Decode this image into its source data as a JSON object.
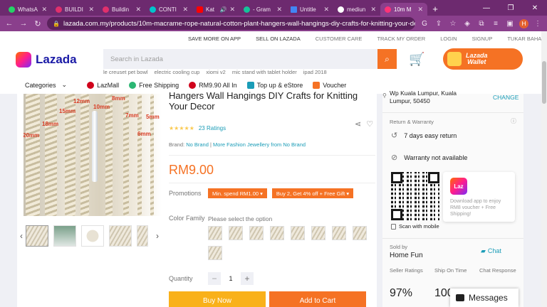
{
  "browser": {
    "tabs": [
      {
        "title": "WhatsA",
        "color": "#25d366",
        "active": false
      },
      {
        "title": "BUILDI",
        "color": "#e1306c",
        "active": false
      },
      {
        "title": "Buildin",
        "color": "#e1306c",
        "active": false
      },
      {
        "title": "CONTI",
        "color": "#00c4cc",
        "active": false
      },
      {
        "title": "Kat",
        "color": "#ff0000",
        "active": false,
        "audio": "🔊"
      },
      {
        "title": "- Gram",
        "color": "#15c39a",
        "active": false
      },
      {
        "title": "Untitle",
        "color": "#4285f4",
        "active": false
      },
      {
        "title": "mediun",
        "color": "#ffffff",
        "active": false
      },
      {
        "title": "10m M",
        "color": "#f36",
        "active": true
      }
    ],
    "new_tab": "+",
    "window_controls": [
      "—",
      "❐",
      "✕"
    ],
    "url": "lazada.com.my/products/10m-macrame-rope-natural-cotton-plant-hangers-wall-hangings-diy-crafts-for-knitting-your-decor-i1...",
    "profile_initial": "H"
  },
  "header": {
    "top_links": [
      "SAVE MORE ON APP",
      "SELL ON LAZADA",
      "CUSTOMER CARE",
      "TRACK MY ORDER",
      "LOGIN",
      "SIGNUP",
      "TUKAR BAHASA"
    ],
    "logo": "Lazada",
    "search_placeholder": "Search in Lazada",
    "wallet": "Lazada\nWallet",
    "suggestions": [
      "le creuset pet bowl",
      "electric cooling cup",
      "xiomi v2",
      "mic stand with tablet holder",
      "ipad 2018"
    ],
    "categories_label": "Categories",
    "nav_items": [
      {
        "label": "LazMall",
        "color": "#d0021b"
      },
      {
        "label": "Free Shipping",
        "color": "#2bb673"
      },
      {
        "label": "RM9.90 All In",
        "color": "#d0021b"
      },
      {
        "label": "Top up & eStore",
        "color": "#1a9cb7"
      },
      {
        "label": "Voucher",
        "color": "#f57224"
      }
    ]
  },
  "product": {
    "image_labels": [
      "12mm",
      "10mm",
      "8mm",
      "15mm",
      "7mm",
      "5mm",
      "18mm",
      "6mm",
      "20mm"
    ],
    "title": "Hangers Wall Hangings DIY Crafts for Knitting Your Decor",
    "stars": "★★★★★",
    "rating_count": "23 Ratings",
    "brand_label": "Brand:",
    "brand": "No Brand",
    "brand_more": "More Fashion Jewellery from No Brand",
    "price": "RM9.00",
    "promotions_label": "Promotions",
    "promotions": [
      "Min. spend RM1.00 ▾",
      "Buy 2, Get 4% off + Free Gift ▾"
    ],
    "color_label": "Color Family",
    "color_hint": "Please select the option",
    "quantity_label": "Quantity",
    "quantity": "1",
    "buy_now": "Buy Now",
    "add_to_cart": "Add to Cart"
  },
  "side": {
    "location": "Wp Kuala Lumpur, Kuala Lumpur, 50450",
    "change": "CHANGE",
    "return_warranty": "Return & Warranty",
    "return_days": "7 days easy return",
    "warranty": "Warranty not available",
    "scan_mobile": "Scan with mobile",
    "laz_icon": "Laz",
    "app_promo": "Download app to enjoy RM8 voucher + Free Shipping!",
    "sold_by": "Sold by",
    "seller": "Home Fun",
    "chat": "Chat",
    "metrics": [
      "Seller Ratings",
      "Ship On Time",
      "Chat Response"
    ],
    "metric_values": [
      "97%",
      "100"
    ],
    "messages": "Messages"
  }
}
